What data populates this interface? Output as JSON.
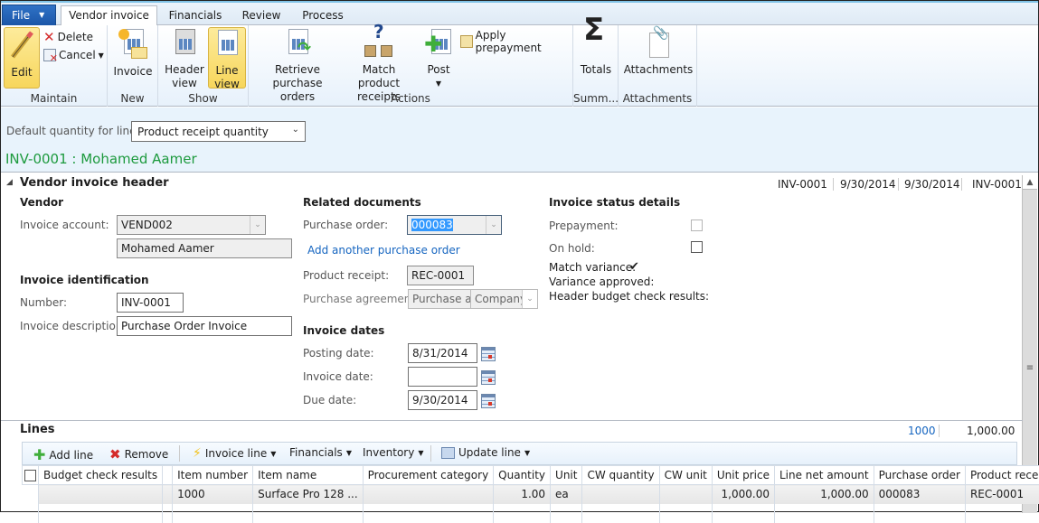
{
  "ribbon_tabs": {
    "file": "File",
    "tabs": [
      "Vendor invoice",
      "Financials",
      "Review",
      "Process"
    ],
    "active": "Vendor invoice"
  },
  "ribbon": {
    "maintain": {
      "label": "Maintain",
      "edit": "Edit",
      "delete": "Delete",
      "cancel": "Cancel"
    },
    "new": {
      "label": "New",
      "invoice": "Invoice"
    },
    "show": {
      "label": "Show",
      "header_view": [
        "Header",
        "view"
      ],
      "line_view": [
        "Line",
        "view"
      ]
    },
    "actions": {
      "label": "Actions",
      "retrieve": [
        "Retrieve",
        "purchase orders"
      ],
      "match": [
        "Match product",
        "receipts"
      ],
      "post": "Post",
      "apply_prepayment": "Apply prepayment"
    },
    "summary": {
      "label": "Summ...",
      "totals": "Totals"
    },
    "attachments": {
      "label": "Attachments",
      "attachments": "Attachments"
    }
  },
  "filter": {
    "default_qty_label": "Default quantity for lines:",
    "default_qty_value": "Product receipt quantity",
    "record_title": "INV-0001 : Mohamed Aamer"
  },
  "header": {
    "title": "Vendor invoice header",
    "summary": [
      "INV-0001",
      "9/30/2014",
      "9/30/2014",
      "INV-0001"
    ],
    "vendor": {
      "heading": "Vendor",
      "invoice_account_label": "Invoice account:",
      "invoice_account": "VEND002",
      "vendor_name": "Mohamed Aamer"
    },
    "identification": {
      "heading": "Invoice identification",
      "number_label": "Number:",
      "number": "INV-0001",
      "description_label": "Invoice description:",
      "description": "Purchase Order Invoice"
    },
    "related": {
      "heading": "Related documents",
      "po_label": "Purchase order:",
      "po": "000083",
      "add_po_link": "Add another purchase order",
      "receipt_label": "Product receipt:",
      "receipt": "REC-0001",
      "agreement_label": "Purchase agreement:",
      "agreement_a": "Purchase a",
      "agreement_b": "Company"
    },
    "dates": {
      "heading": "Invoice dates",
      "posting_label": "Posting date:",
      "posting": "8/31/2014",
      "invoice_label": "Invoice date:",
      "invoice": "",
      "due_label": "Due date:",
      "due": "9/30/2014"
    },
    "status": {
      "heading": "Invoice status details",
      "prepayment_label": "Prepayment:",
      "prepayment": false,
      "on_hold_label": "On hold:",
      "on_hold": false,
      "match_variance_label": "Match variance:",
      "match_variance": "✔",
      "variance_approved_label": "Variance approved:",
      "budget_label": "Header budget check results:"
    }
  },
  "lines": {
    "title": "Lines",
    "summary": [
      "1000",
      "1,000.00"
    ],
    "toolbar": {
      "add": "Add line",
      "remove": "Remove",
      "invoice_line": "Invoice line",
      "financials": "Financials",
      "inventory": "Inventory",
      "update_line": "Update line"
    },
    "columns": [
      "",
      "Budget check results",
      "",
      "Item number",
      "Item name",
      "Procurement category",
      "Quantity",
      "Unit",
      "CW quantity",
      "CW unit",
      "Unit price",
      "Line net amount",
      "Purchase order",
      "Product receipt"
    ],
    "rows": [
      [
        "",
        "",
        "",
        "1000",
        "Surface Pro 128 ...",
        "",
        "1.00",
        "ea",
        "",
        "",
        "1,000.00",
        "1,000.00",
        "000083",
        "REC-0001"
      ]
    ]
  }
}
